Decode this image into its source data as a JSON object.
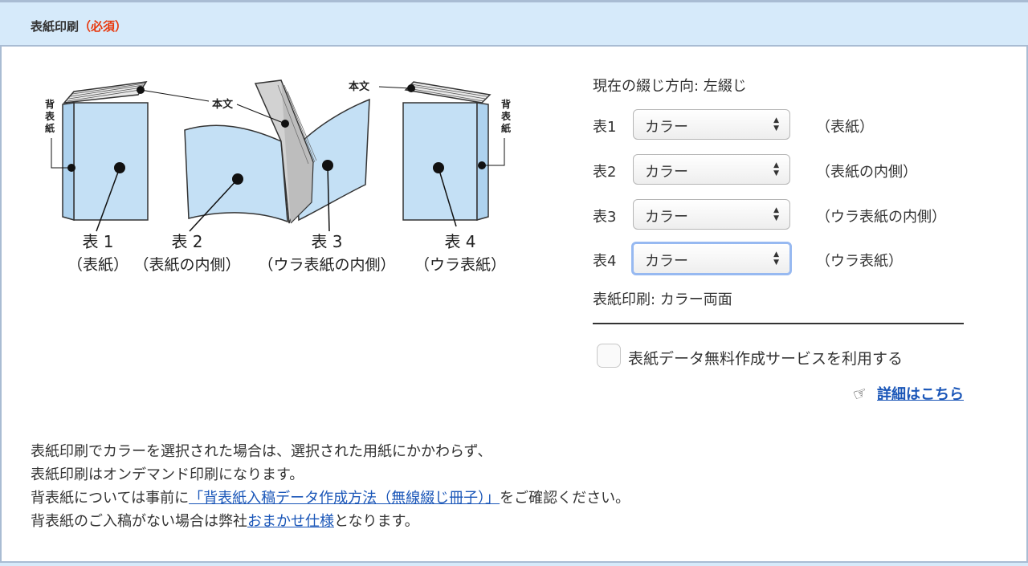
{
  "section": {
    "title": "表紙印刷",
    "required": "（必須）"
  },
  "diagram": {
    "body_text": "本文",
    "spine_chars": [
      "背",
      "表",
      "紙"
    ],
    "covers": [
      {
        "num": "表 1",
        "desc": "（表紙）"
      },
      {
        "num": "表 2",
        "desc": "（表紙の内側）"
      },
      {
        "num": "表 3",
        "desc": "（ウラ表紙の内側）"
      },
      {
        "num": "表 4",
        "desc": "（ウラ表紙）"
      }
    ]
  },
  "panel": {
    "binding_direction": "現在の綴じ方向: 左綴じ",
    "rows": [
      {
        "label": "表1",
        "value": "カラー",
        "note": "（表紙）"
      },
      {
        "label": "表2",
        "value": "カラー",
        "note": "（表紙の内側）"
      },
      {
        "label": "表3",
        "value": "カラー",
        "note": "（ウラ表紙の内側）"
      },
      {
        "label": "表4",
        "value": "カラー",
        "note": "（ウラ表紙）"
      }
    ],
    "summary": "表紙印刷: カラー両面",
    "free_service": {
      "label": "表紙データ無料作成サービスを利用する",
      "checked": false
    },
    "details_link": "詳細はこちら"
  },
  "notes": {
    "line1": "表紙印刷でカラーを選択された場合は、選択された用紙にかかわらず、",
    "line2": "表紙印刷はオンデマンド印刷になります。",
    "line3_before": "背表紙については事前に",
    "line3_link": "「背表紙入稿データ作成方法（無線綴じ冊子）」",
    "line3_after": "をご確認ください。",
    "line4_before": "背表紙のご入稿がない場合は弊社",
    "line4_link": "おまかせ仕様",
    "line4_after": "となります。"
  },
  "colors": {
    "header_bg": "#d6eafa",
    "border": "#a9bcd3",
    "required": "#e8380d",
    "link": "#1a56b8",
    "cover_blue": "#c4e0f5",
    "pages_gray": "#d2d2d2"
  }
}
